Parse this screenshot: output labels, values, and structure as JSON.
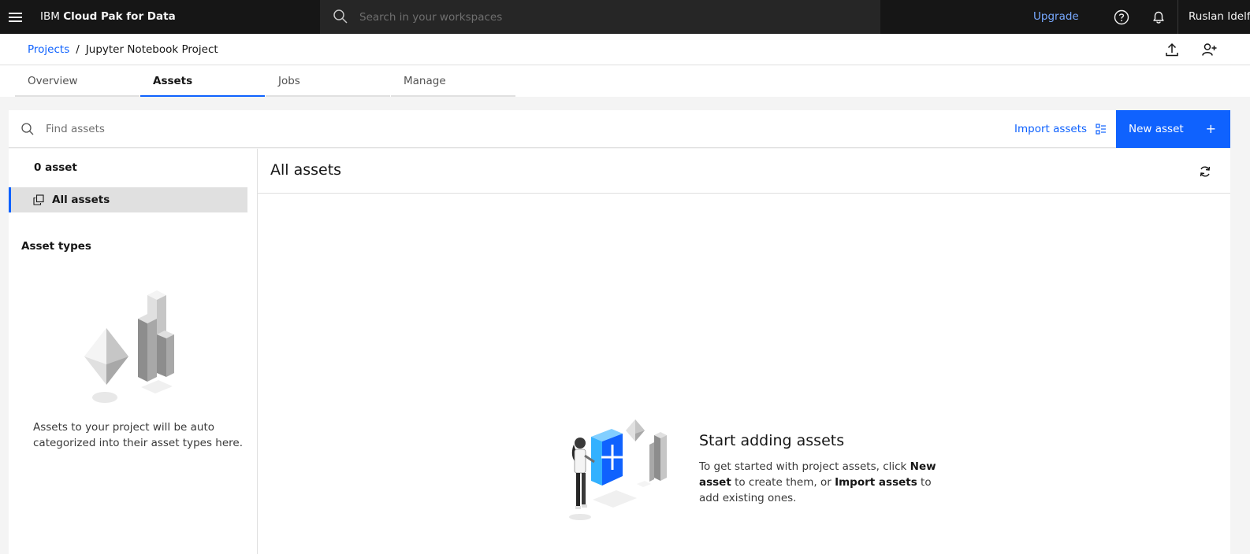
{
  "header": {
    "brand_prefix": "IBM ",
    "brand_name": "Cloud Pak for Data",
    "search_placeholder": "Search in your workspaces",
    "upgrade_label": "Upgrade",
    "user_name": "Ruslan Idelfonso",
    "icons": [
      "hamburger-menu-icon",
      "search-icon",
      "help-icon",
      "notification-icon"
    ]
  },
  "breadcrumb": {
    "projects_label": "Projects",
    "separator": "/",
    "current": "Jupyter Notebook Project"
  },
  "tabs": [
    {
      "label": "Overview",
      "active": false
    },
    {
      "label": "Assets",
      "active": true
    },
    {
      "label": "Jobs",
      "active": false
    },
    {
      "label": "Manage",
      "active": false
    }
  ],
  "toolbar": {
    "find_placeholder": "Find assets",
    "import_label": "Import assets",
    "new_asset_label": "New asset",
    "new_asset_plus": "+"
  },
  "sidebar": {
    "asset_count": "0 asset",
    "all_assets_label": "All assets",
    "asset_types_heading": "Asset types",
    "note": "Assets to your project will be auto categorized into their asset types here."
  },
  "main": {
    "title": "All assets",
    "empty_title": "Start adding assets",
    "empty_desc_1": "To get started with project assets, click ",
    "empty_desc_bold_1": "New asset",
    "empty_desc_2": " to create them, or ",
    "empty_desc_bold_2": "Import assets",
    "empty_desc_3": " to add existing ones."
  },
  "colors": {
    "accent": "#0f62fe",
    "header_bg": "#161616",
    "upgrade_link": "#78a9ff"
  }
}
